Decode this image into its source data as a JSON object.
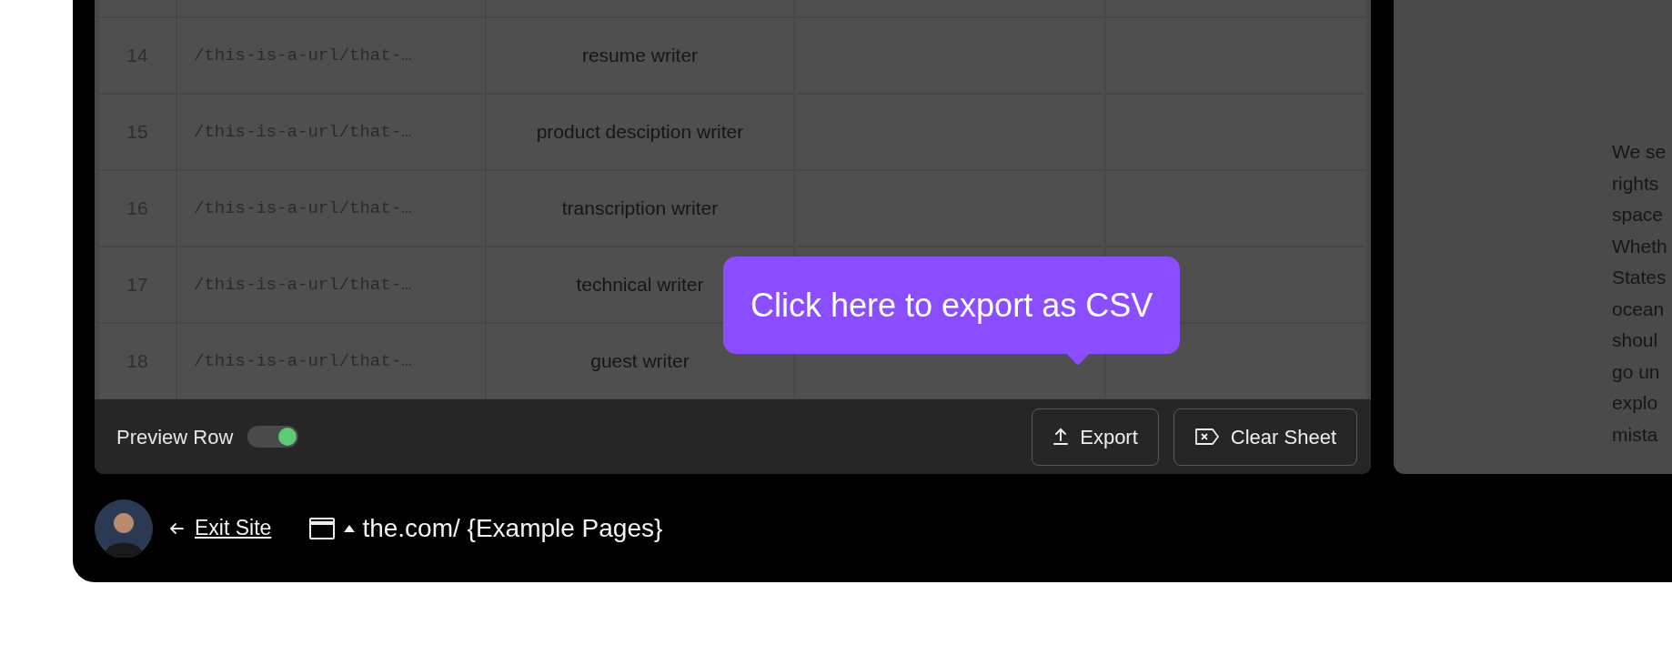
{
  "table": {
    "rows": [
      {
        "number": "14",
        "url": "/this-is-a-url/that-…",
        "keyword": "resume writer"
      },
      {
        "number": "15",
        "url": "/this-is-a-url/that-…",
        "keyword": "product desciption writer"
      },
      {
        "number": "16",
        "url": "/this-is-a-url/that-…",
        "keyword": "transcription writer"
      },
      {
        "number": "17",
        "url": "/this-is-a-url/that-…",
        "keyword": "technical writer"
      },
      {
        "number": "18",
        "url": "/this-is-a-url/that-…",
        "keyword": "guest writer"
      }
    ]
  },
  "tooltip": {
    "text": "Click here to export as CSV"
  },
  "toolbar": {
    "preview_row": {
      "label": "Preview Row",
      "on": true
    },
    "buttons": [
      {
        "label": "Export",
        "kind": "export"
      },
      {
        "label": "Clear Sheet",
        "kind": "clear"
      }
    ]
  },
  "side_panel": {
    "lines": [
      "We se",
      "rights",
      "space",
      "Wheth",
      "States",
      "ocean",
      "shoul",
      "go un",
      "explo",
      "mista"
    ]
  },
  "footer": {
    "exit_label": "Exit Site",
    "site_path": "the.com/ {Example Pages}"
  }
}
